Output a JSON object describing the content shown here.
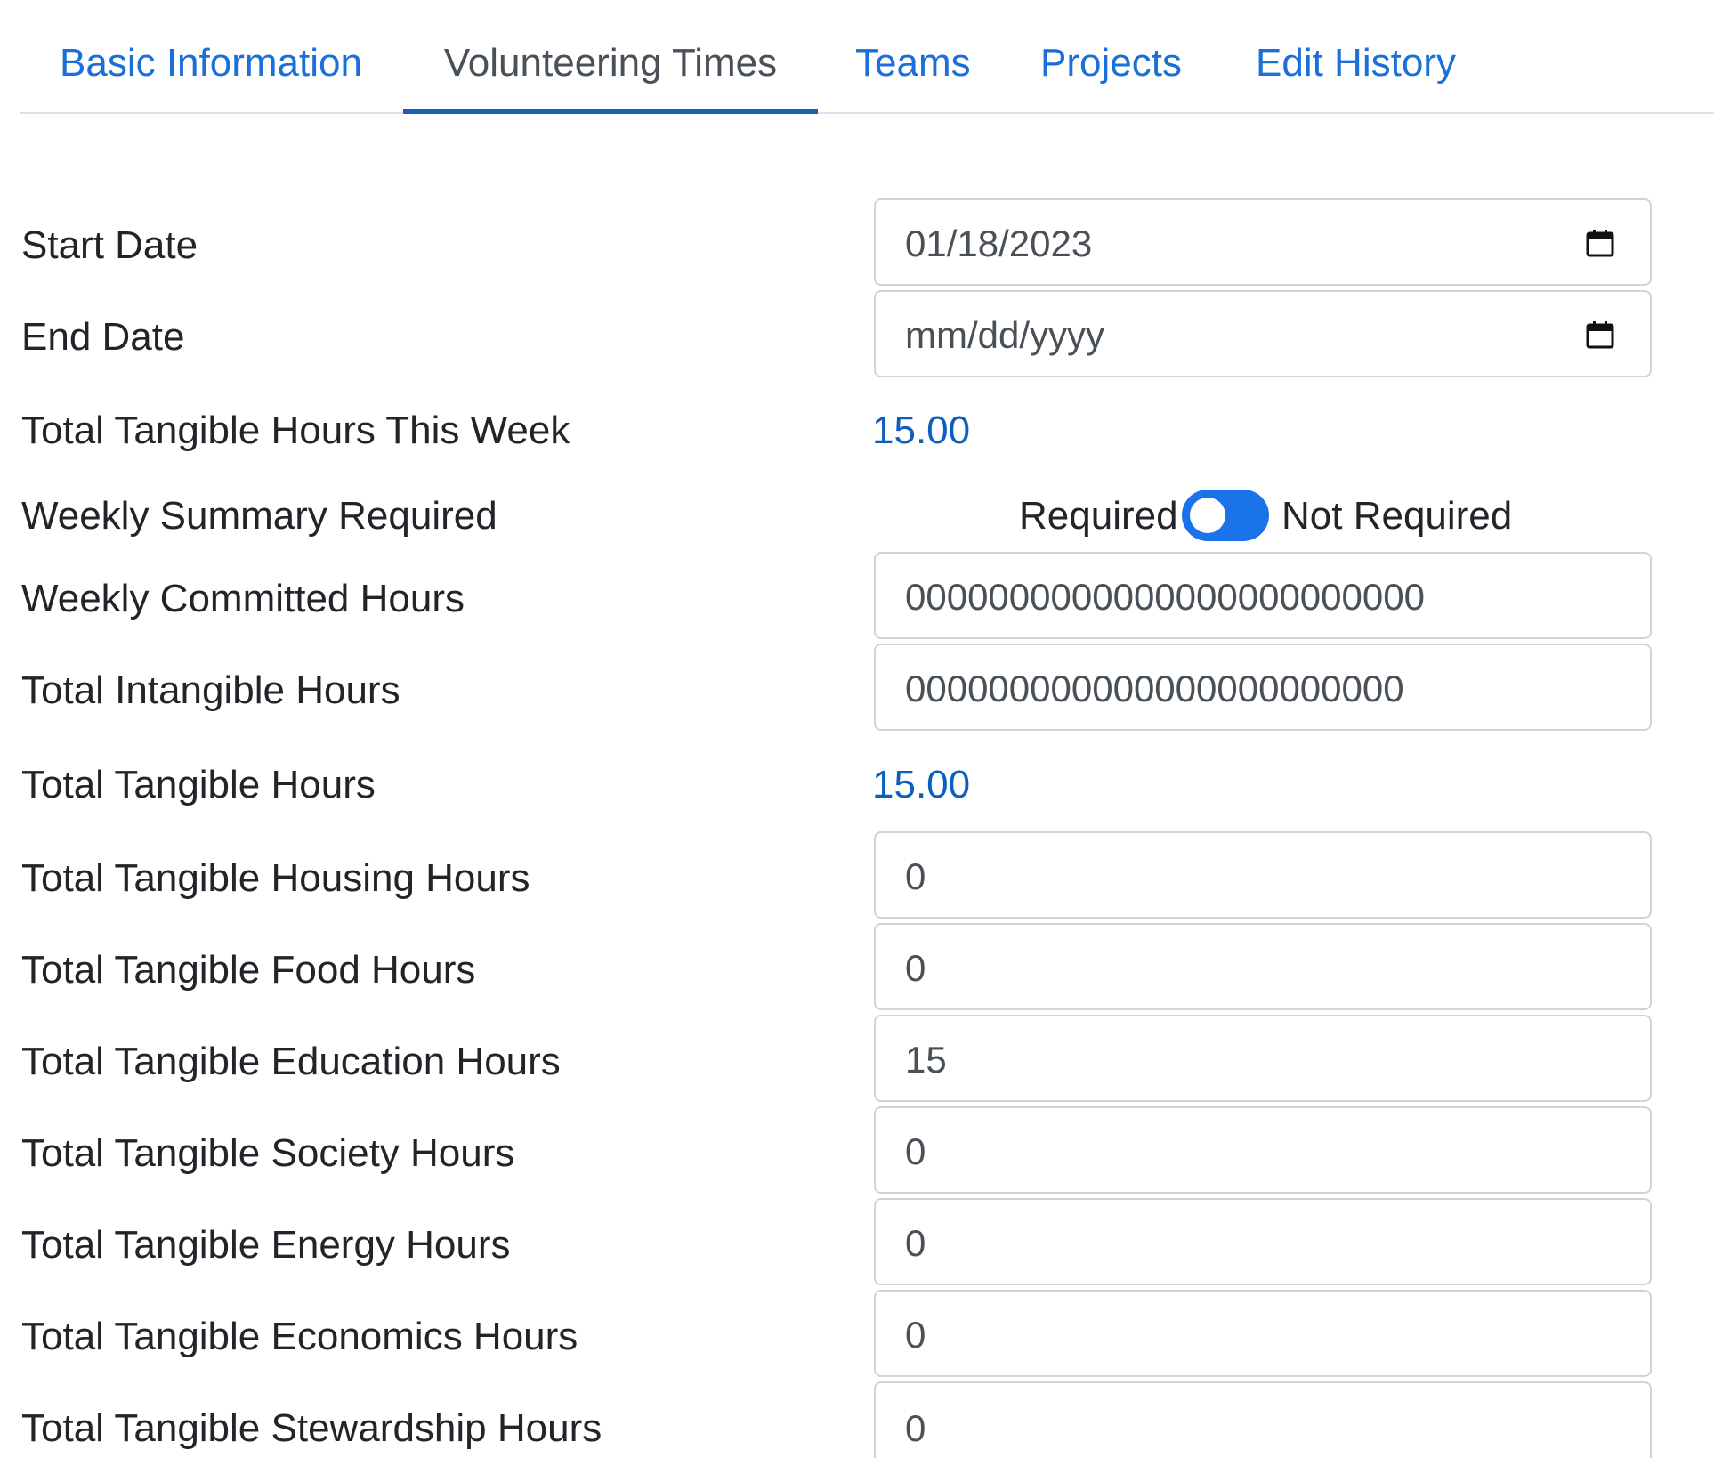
{
  "tabs": [
    {
      "label": "Basic Information"
    },
    {
      "label": "Volunteering Times"
    },
    {
      "label": "Teams"
    },
    {
      "label": "Projects"
    },
    {
      "label": "Edit History"
    }
  ],
  "active_tab": "Volunteering Times",
  "form": {
    "start_date": {
      "label": "Start Date",
      "value": "01/18/2023"
    },
    "end_date": {
      "label": "End Date",
      "placeholder": "mm/dd/yyyy"
    },
    "tangible_week": {
      "label": "Total Tangible Hours This Week",
      "value": "15.00"
    },
    "weekly_summary": {
      "label": "Weekly Summary Required",
      "left_label": "Required",
      "right_label": "Not Required"
    },
    "weekly_committed": {
      "label": "Weekly Committed Hours",
      "value": "0000000000000000000000000"
    },
    "total_intangible": {
      "label": "Total Intangible Hours",
      "value": "000000000000000000000000"
    },
    "total_tangible": {
      "label": "Total Tangible Hours",
      "value": "15.00"
    },
    "housing": {
      "label": "Total Tangible Housing Hours",
      "value": "0"
    },
    "food": {
      "label": "Total Tangible Food Hours",
      "value": "0"
    },
    "education": {
      "label": "Total Tangible Education Hours",
      "value": "15"
    },
    "society": {
      "label": "Total Tangible Society Hours",
      "value": "0"
    },
    "energy": {
      "label": "Total Tangible Energy Hours",
      "value": "0"
    },
    "economics": {
      "label": "Total Tangible Economics Hours",
      "value": "0"
    },
    "stewardship": {
      "label": "Total Tangible Stewardship Hours",
      "value": "0"
    }
  },
  "colors": {
    "link": "#1a6fd9",
    "value_blue": "#0d5fbf",
    "toggle": "#1a73e8"
  }
}
